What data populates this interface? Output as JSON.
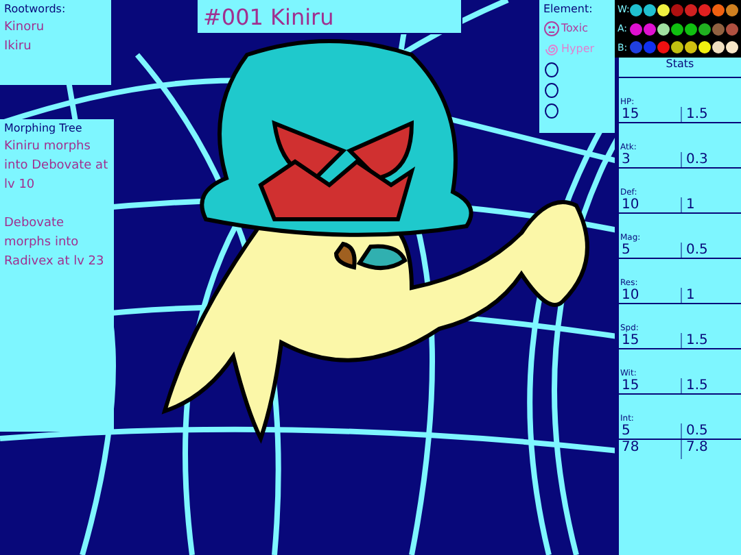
{
  "title": "#001 Kiniru",
  "rootwords": {
    "heading": "Rootwords:",
    "words": [
      "Kinoru",
      "Ikiru"
    ]
  },
  "morphing_tree": {
    "heading": "Morphing Tree",
    "entries": [
      "Kiniru morphs into Debovate at lv 10",
      "Debovate morphs into Radivex at lv 23"
    ]
  },
  "element": {
    "heading": "Element:",
    "items": [
      {
        "kind": "skull",
        "label": "Toxic",
        "color": "#b040a0"
      },
      {
        "kind": "spiral",
        "label": "Hyper",
        "color": "#e080d0"
      },
      {
        "kind": "empty"
      },
      {
        "kind": "empty"
      },
      {
        "kind": "empty"
      }
    ]
  },
  "palette": [
    {
      "label": "W:",
      "swatches": [
        {
          "color": "#20c0d0"
        },
        {
          "color": "#20c0d0"
        },
        {
          "color": "#f0f040"
        },
        {
          "color": "#b01010"
        },
        {
          "color": "#d02020"
        },
        {
          "color": "#e02020"
        },
        {
          "color": "#f06010"
        },
        {
          "color": "#d08020"
        }
      ]
    },
    {
      "label": "A:",
      "swatches": [
        {
          "color": "#e010d0"
        },
        {
          "color": "#e010d0"
        },
        {
          "color": "#a0e0a0"
        },
        {
          "color": "#10c010"
        },
        {
          "color": "#10c010"
        },
        {
          "color": "#20b020"
        },
        {
          "color": "#906040"
        },
        {
          "color": "#b05040"
        }
      ]
    },
    {
      "label": "B:",
      "swatches": [
        {
          "color": "#2040e0"
        },
        {
          "color": "#1030f0"
        },
        {
          "color": "#f01010"
        },
        {
          "color": "#c0c010"
        },
        {
          "color": "#d0c010"
        },
        {
          "color": "#f0f010"
        },
        {
          "color": "#f0e0c0"
        },
        {
          "color": "#f8e8c8"
        }
      ]
    }
  ],
  "stats": {
    "heading": "Stats",
    "rows": [
      {
        "label": "HP:",
        "value": "15",
        "growth": "1.5"
      },
      {
        "label": "Atk:",
        "value": "3",
        "growth": "0.3"
      },
      {
        "label": "Def:",
        "value": "10",
        "growth": "1"
      },
      {
        "label": "Mag:",
        "value": "5",
        "growth": "0.5"
      },
      {
        "label": "Res:",
        "value": "10",
        "growth": "1"
      },
      {
        "label": "Spd:",
        "value": "15",
        "growth": "1.5"
      },
      {
        "label": "Wit:",
        "value": "15",
        "growth": "1.5"
      },
      {
        "label": "Int:",
        "value": "5",
        "growth": "0.5"
      }
    ],
    "total": {
      "value": "78",
      "growth": "7.8"
    }
  }
}
